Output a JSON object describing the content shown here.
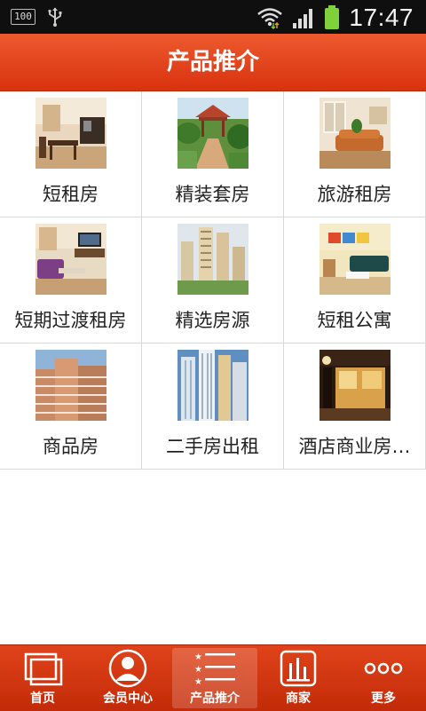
{
  "status_bar": {
    "battery_badge": "100",
    "time": "17:47"
  },
  "header": {
    "title": "产品推介"
  },
  "products": [
    {
      "label": "短租房",
      "thumb": "living-room"
    },
    {
      "label": "精装套房",
      "thumb": "garden-pavilion"
    },
    {
      "label": "旅游租房",
      "thumb": "sofa-room"
    },
    {
      "label": "短期过渡租房",
      "thumb": "purple-living-room"
    },
    {
      "label": "精选房源",
      "thumb": "residential-towers"
    },
    {
      "label": "短租公寓",
      "thumb": "green-sofa-room"
    },
    {
      "label": "商品房",
      "thumb": "apartment-blocks"
    },
    {
      "label": "二手房出租",
      "thumb": "high-rise-towers"
    },
    {
      "label": "酒店商业房…",
      "thumb": "hotel-storefront"
    }
  ],
  "bottom_nav": [
    {
      "label": "首页",
      "icon": "home-icon"
    },
    {
      "label": "会员中心",
      "icon": "member-icon"
    },
    {
      "label": "产品推介",
      "icon": "list-icon",
      "active": true
    },
    {
      "label": "商家",
      "icon": "merchant-icon"
    },
    {
      "label": "更多",
      "icon": "more-icon"
    }
  ],
  "colors": {
    "accent": "#e0431a",
    "header_top": "#ee5a2e",
    "header_bottom": "#d8320e"
  }
}
